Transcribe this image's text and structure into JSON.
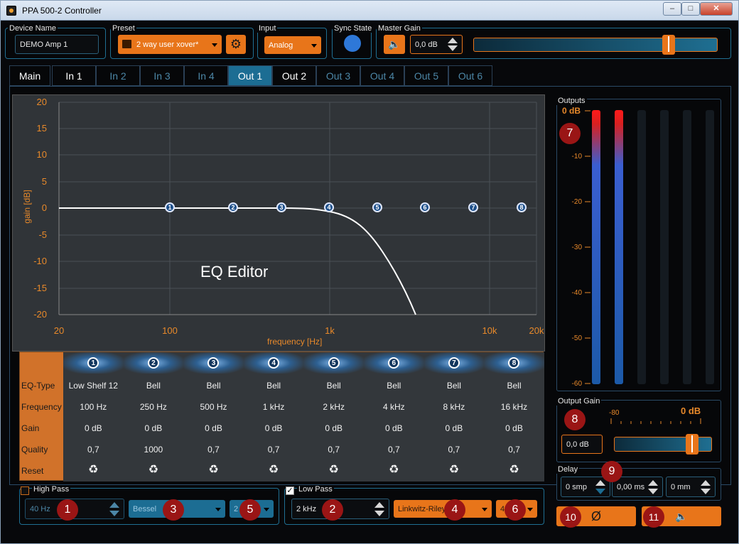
{
  "window": {
    "title": "PPA 500-2 Controller",
    "minimize": "–",
    "maximize": "□",
    "close": "✕"
  },
  "device": {
    "label": "Device Name",
    "value": "DEMO Amp 1"
  },
  "preset": {
    "label": "Preset",
    "value": "2 way user xover*"
  },
  "input": {
    "label": "Input",
    "value": "Analog"
  },
  "sync": {
    "label": "Sync State"
  },
  "master": {
    "label": "Master Gain",
    "value": "0,0 dB",
    "slider_level": 0.9
  },
  "tabs": [
    "Main",
    "In 1",
    "In 2",
    "In 3",
    "In 4",
    "Out 1",
    "Out 2",
    "Out 3",
    "Out 4",
    "Out 5",
    "Out 6"
  ],
  "eq": {
    "title": "EQ Editor",
    "ylabel": "gain [dB]",
    "xlabel": "frequency [Hz]",
    "yticks": [
      "20",
      "15",
      "10",
      "5",
      "0",
      "-5",
      "-10",
      "-15",
      "-20"
    ],
    "xticks": [
      "20",
      "100",
      "1k",
      "10k",
      "20k"
    ],
    "row_labels": [
      "EQ-Type",
      "Frequency",
      "Gain",
      "Quality",
      "Reset"
    ],
    "bands": [
      {
        "n": "1",
        "type": "Low Shelf 12",
        "freq": "100 Hz",
        "gain": "0 dB",
        "q": "0,7"
      },
      {
        "n": "2",
        "type": "Bell",
        "freq": "250 Hz",
        "gain": "0 dB",
        "q": "1000"
      },
      {
        "n": "3",
        "type": "Bell",
        "freq": "500 Hz",
        "gain": "0 dB",
        "q": "0,7"
      },
      {
        "n": "4",
        "type": "Bell",
        "freq": "1 kHz",
        "gain": "0 dB",
        "q": "0,7"
      },
      {
        "n": "5",
        "type": "Bell",
        "freq": "2 kHz",
        "gain": "0 dB",
        "q": "0,7"
      },
      {
        "n": "6",
        "type": "Bell",
        "freq": "4 kHz",
        "gain": "0 dB",
        "q": "0,7"
      },
      {
        "n": "7",
        "type": "Bell",
        "freq": "8 kHz",
        "gain": "0 dB",
        "q": "0,7"
      },
      {
        "n": "8",
        "type": "Bell",
        "freq": "16 kHz",
        "gain": "0 dB",
        "q": "0,7"
      }
    ],
    "reset_icon": "♻"
  },
  "highpass": {
    "label": "High Pass",
    "freq": "40 Hz",
    "type": "Bessel",
    "order": "2"
  },
  "lowpass": {
    "label": "Low Pass",
    "freq": "2 kHz",
    "type": "Linkwitz-Riley",
    "order": "4"
  },
  "outputs": {
    "label": "Outputs",
    "peak": "0 dB",
    "ticks": [
      "-10",
      "-20",
      "-30",
      "-40",
      "-50",
      "-60"
    ]
  },
  "output_gain": {
    "label": "Output Gain",
    "value": "0,0 dB",
    "min": "-80",
    "max": "0 dB",
    "slider_level": 0.9
  },
  "delay": {
    "label": "Delay",
    "smp": "0 smp",
    "ms": "0,00 ms",
    "mm": "0 mm"
  },
  "badges": [
    "1",
    "2",
    "3",
    "4",
    "5",
    "6",
    "7",
    "8",
    "9",
    "10",
    "11"
  ],
  "buttons": {
    "phase": "Ø",
    "mute": "🔈"
  }
}
